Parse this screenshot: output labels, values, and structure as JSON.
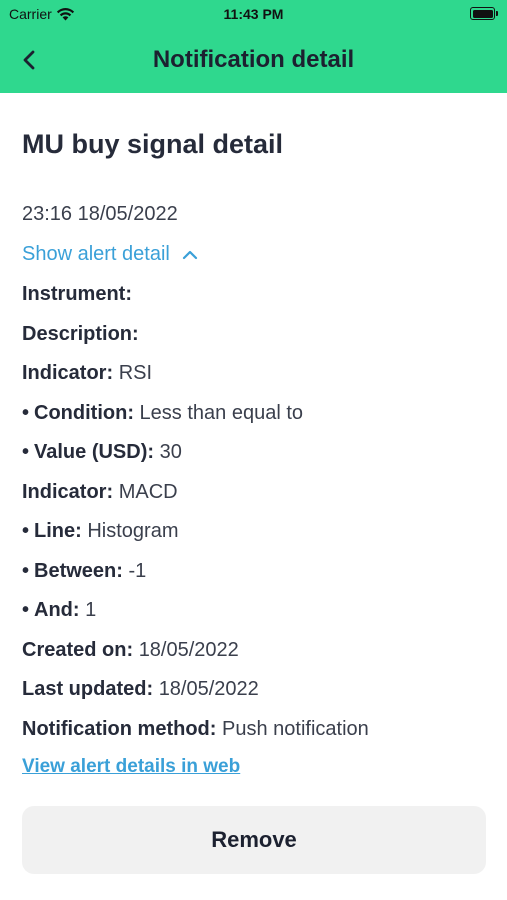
{
  "status_bar": {
    "carrier": "Carrier",
    "time": "11:43 PM"
  },
  "nav": {
    "title": "Notification detail"
  },
  "detail": {
    "title": "MU buy signal detail",
    "timestamp": "23:16 18/05/2022",
    "toggle_label": "Show alert detail",
    "bullet": "•",
    "rows": [
      {
        "label": "Instrument:",
        "value": "",
        "bullet": false
      },
      {
        "label": "Description:",
        "value": "",
        "bullet": false
      },
      {
        "label": "Indicator:",
        "value": "RSI",
        "bullet": false
      },
      {
        "label": "Condition:",
        "value": "Less than equal to",
        "bullet": true
      },
      {
        "label": "Value (USD):",
        "value": "30",
        "bullet": true
      },
      {
        "label": "Indicator:",
        "value": "MACD",
        "bullet": false
      },
      {
        "label": "Line:",
        "value": "Histogram",
        "bullet": true
      },
      {
        "label": "Between:",
        "value": "-1",
        "bullet": true
      },
      {
        "label": "And:",
        "value": "1",
        "bullet": true
      },
      {
        "label": "Created on:",
        "value": "18/05/2022",
        "bullet": false
      },
      {
        "label": "Last updated:",
        "value": "18/05/2022",
        "bullet": false
      },
      {
        "label": "Notification method:",
        "value": "Push notification",
        "bullet": false
      }
    ],
    "web_link": "View alert details in web"
  },
  "actions": {
    "remove_label": "Remove"
  },
  "colors": {
    "header": "#2fd88e",
    "link": "#3aa0d8",
    "button_bg": "#f1f1f1"
  }
}
